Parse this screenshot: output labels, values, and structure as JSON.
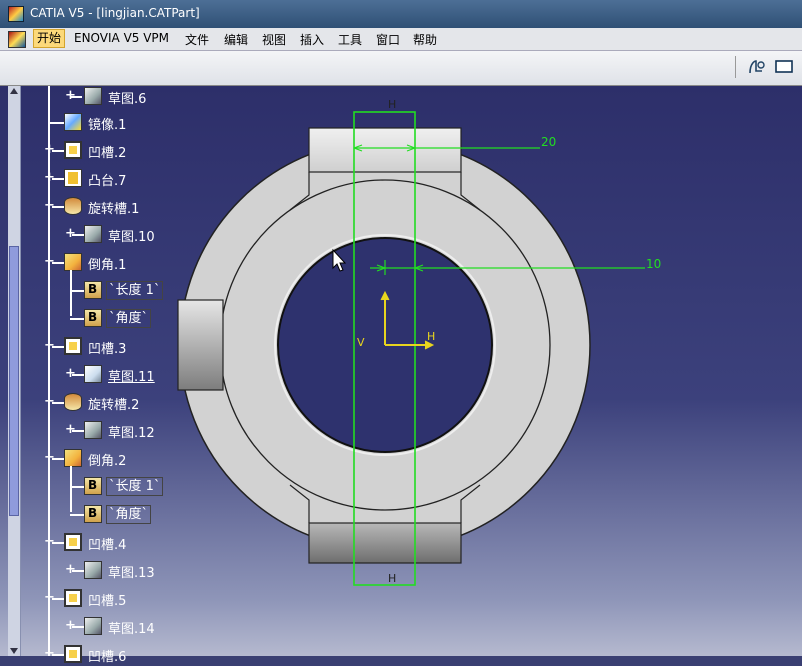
{
  "window": {
    "title": "CATIA V5 - [lingjian.CATPart]"
  },
  "menu": [
    "开始",
    "ENOVIA V5 VPM",
    "文件",
    "编辑",
    "视图",
    "插入",
    "工具",
    "窗口",
    "帮助"
  ],
  "tree": {
    "items": [
      {
        "label": "草图.6",
        "icon": "sketch-icon"
      },
      {
        "label": "镜像.1",
        "icon": "mirror-icon"
      },
      {
        "label": "凹槽.2",
        "icon": "pocket-icon"
      },
      {
        "label": "凸台.7",
        "icon": "pad-icon"
      },
      {
        "label": "旋转槽.1",
        "icon": "groove-icon"
      },
      {
        "label": "草图.10",
        "icon": "sketch-icon"
      },
      {
        "label": "倒角.1",
        "icon": "chamfer-icon"
      },
      {
        "label": "`长度 1`",
        "icon": "parameter-icon"
      },
      {
        "label": "`角度`",
        "icon": "parameter-icon"
      },
      {
        "label": "凹槽.3",
        "icon": "pocket-icon"
      },
      {
        "label": "草图.11",
        "icon": "sketch-active-icon"
      },
      {
        "label": "旋转槽.2",
        "icon": "groove-icon"
      },
      {
        "label": "草图.12",
        "icon": "sketch-icon"
      },
      {
        "label": "倒角.2",
        "icon": "chamfer-icon"
      },
      {
        "label": "`长度 1`",
        "icon": "parameter-icon"
      },
      {
        "label": "`角度`",
        "icon": "parameter-icon"
      },
      {
        "label": "凹槽.4",
        "icon": "pocket-icon"
      },
      {
        "label": "草图.13",
        "icon": "sketch-icon"
      },
      {
        "label": "凹槽.5",
        "icon": "pocket-icon"
      },
      {
        "label": "草图.14",
        "icon": "sketch-icon"
      },
      {
        "label": "凹槽.6",
        "icon": "pocket-icon"
      }
    ]
  },
  "canvas": {
    "constraint_top": "H",
    "constraint_bottom": "H",
    "dim_width": "20",
    "dim_offset": "10",
    "axis_v": "V",
    "axis_h": "H",
    "colors": {
      "sketch": "#22dd22",
      "axis": "#e8d51e",
      "part": "#d2d2d2"
    }
  }
}
